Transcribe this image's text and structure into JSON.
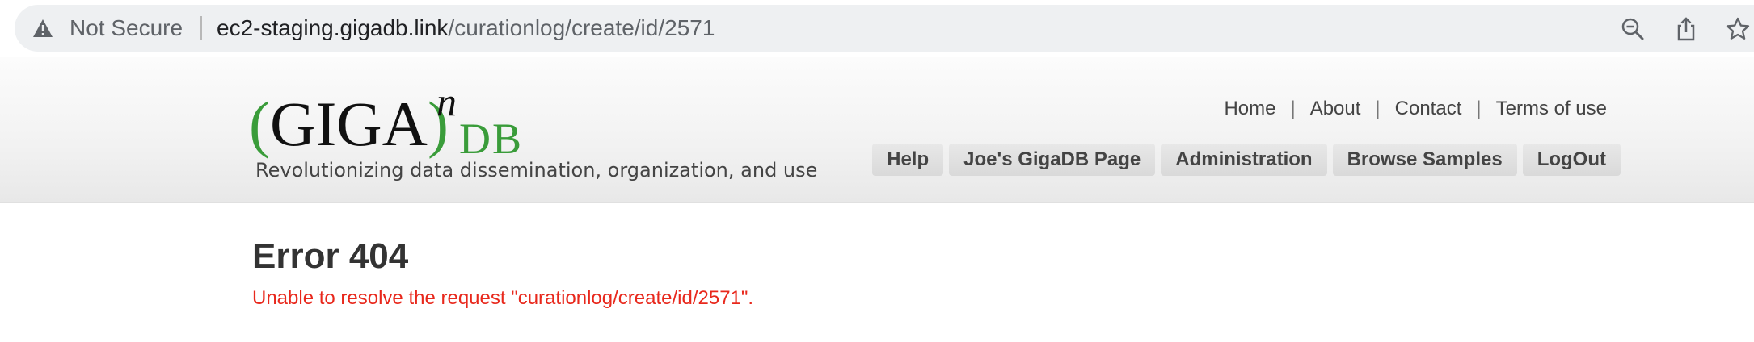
{
  "browser": {
    "security_label": "Not Secure",
    "url_host": "ec2-staging.gigadb.link",
    "url_path": "/curationlog/create/id/2571",
    "icons": [
      "warning-icon",
      "zoom-out-icon",
      "share-icon",
      "star-icon"
    ]
  },
  "site": {
    "logo": {
      "main": "GIGA",
      "superscript": "n",
      "suffix": "DB",
      "tagline": "Revolutionizing data dissemination, organization, and use"
    },
    "top_links": [
      "Home",
      "About",
      "Contact",
      "Terms of use"
    ],
    "nav_buttons": [
      "Help",
      "Joe's GigaDB Page",
      "Administration",
      "Browse Samples",
      "LogOut"
    ],
    "colors": {
      "logo_green": "#3a9c3a",
      "error_red": "#e8281c"
    }
  },
  "error": {
    "title": "Error 404",
    "message": "Unable to resolve the request \"curationlog/create/id/2571\"."
  }
}
